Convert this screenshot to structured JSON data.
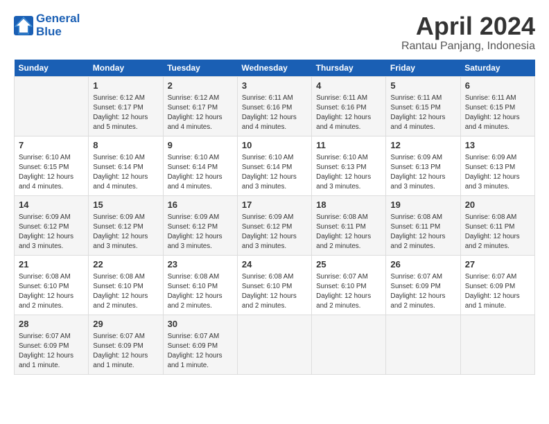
{
  "header": {
    "logo_line1": "General",
    "logo_line2": "Blue",
    "title": "April 2024",
    "subtitle": "Rantau Panjang, Indonesia"
  },
  "days_of_week": [
    "Sunday",
    "Monday",
    "Tuesday",
    "Wednesday",
    "Thursday",
    "Friday",
    "Saturday"
  ],
  "weeks": [
    [
      {
        "num": "",
        "info": ""
      },
      {
        "num": "1",
        "info": "Sunrise: 6:12 AM\nSunset: 6:17 PM\nDaylight: 12 hours\nand 5 minutes."
      },
      {
        "num": "2",
        "info": "Sunrise: 6:12 AM\nSunset: 6:17 PM\nDaylight: 12 hours\nand 4 minutes."
      },
      {
        "num": "3",
        "info": "Sunrise: 6:11 AM\nSunset: 6:16 PM\nDaylight: 12 hours\nand 4 minutes."
      },
      {
        "num": "4",
        "info": "Sunrise: 6:11 AM\nSunset: 6:16 PM\nDaylight: 12 hours\nand 4 minutes."
      },
      {
        "num": "5",
        "info": "Sunrise: 6:11 AM\nSunset: 6:15 PM\nDaylight: 12 hours\nand 4 minutes."
      },
      {
        "num": "6",
        "info": "Sunrise: 6:11 AM\nSunset: 6:15 PM\nDaylight: 12 hours\nand 4 minutes."
      }
    ],
    [
      {
        "num": "7",
        "info": "Sunrise: 6:10 AM\nSunset: 6:15 PM\nDaylight: 12 hours\nand 4 minutes."
      },
      {
        "num": "8",
        "info": "Sunrise: 6:10 AM\nSunset: 6:14 PM\nDaylight: 12 hours\nand 4 minutes."
      },
      {
        "num": "9",
        "info": "Sunrise: 6:10 AM\nSunset: 6:14 PM\nDaylight: 12 hours\nand 4 minutes."
      },
      {
        "num": "10",
        "info": "Sunrise: 6:10 AM\nSunset: 6:14 PM\nDaylight: 12 hours\nand 3 minutes."
      },
      {
        "num": "11",
        "info": "Sunrise: 6:10 AM\nSunset: 6:13 PM\nDaylight: 12 hours\nand 3 minutes."
      },
      {
        "num": "12",
        "info": "Sunrise: 6:09 AM\nSunset: 6:13 PM\nDaylight: 12 hours\nand 3 minutes."
      },
      {
        "num": "13",
        "info": "Sunrise: 6:09 AM\nSunset: 6:13 PM\nDaylight: 12 hours\nand 3 minutes."
      }
    ],
    [
      {
        "num": "14",
        "info": "Sunrise: 6:09 AM\nSunset: 6:12 PM\nDaylight: 12 hours\nand 3 minutes."
      },
      {
        "num": "15",
        "info": "Sunrise: 6:09 AM\nSunset: 6:12 PM\nDaylight: 12 hours\nand 3 minutes."
      },
      {
        "num": "16",
        "info": "Sunrise: 6:09 AM\nSunset: 6:12 PM\nDaylight: 12 hours\nand 3 minutes."
      },
      {
        "num": "17",
        "info": "Sunrise: 6:09 AM\nSunset: 6:12 PM\nDaylight: 12 hours\nand 3 minutes."
      },
      {
        "num": "18",
        "info": "Sunrise: 6:08 AM\nSunset: 6:11 PM\nDaylight: 12 hours\nand 2 minutes."
      },
      {
        "num": "19",
        "info": "Sunrise: 6:08 AM\nSunset: 6:11 PM\nDaylight: 12 hours\nand 2 minutes."
      },
      {
        "num": "20",
        "info": "Sunrise: 6:08 AM\nSunset: 6:11 PM\nDaylight: 12 hours\nand 2 minutes."
      }
    ],
    [
      {
        "num": "21",
        "info": "Sunrise: 6:08 AM\nSunset: 6:10 PM\nDaylight: 12 hours\nand 2 minutes."
      },
      {
        "num": "22",
        "info": "Sunrise: 6:08 AM\nSunset: 6:10 PM\nDaylight: 12 hours\nand 2 minutes."
      },
      {
        "num": "23",
        "info": "Sunrise: 6:08 AM\nSunset: 6:10 PM\nDaylight: 12 hours\nand 2 minutes."
      },
      {
        "num": "24",
        "info": "Sunrise: 6:08 AM\nSunset: 6:10 PM\nDaylight: 12 hours\nand 2 minutes."
      },
      {
        "num": "25",
        "info": "Sunrise: 6:07 AM\nSunset: 6:10 PM\nDaylight: 12 hours\nand 2 minutes."
      },
      {
        "num": "26",
        "info": "Sunrise: 6:07 AM\nSunset: 6:09 PM\nDaylight: 12 hours\nand 2 minutes."
      },
      {
        "num": "27",
        "info": "Sunrise: 6:07 AM\nSunset: 6:09 PM\nDaylight: 12 hours\nand 1 minute."
      }
    ],
    [
      {
        "num": "28",
        "info": "Sunrise: 6:07 AM\nSunset: 6:09 PM\nDaylight: 12 hours\nand 1 minute."
      },
      {
        "num": "29",
        "info": "Sunrise: 6:07 AM\nSunset: 6:09 PM\nDaylight: 12 hours\nand 1 minute."
      },
      {
        "num": "30",
        "info": "Sunrise: 6:07 AM\nSunset: 6:09 PM\nDaylight: 12 hours\nand 1 minute."
      },
      {
        "num": "",
        "info": ""
      },
      {
        "num": "",
        "info": ""
      },
      {
        "num": "",
        "info": ""
      },
      {
        "num": "",
        "info": ""
      }
    ]
  ]
}
